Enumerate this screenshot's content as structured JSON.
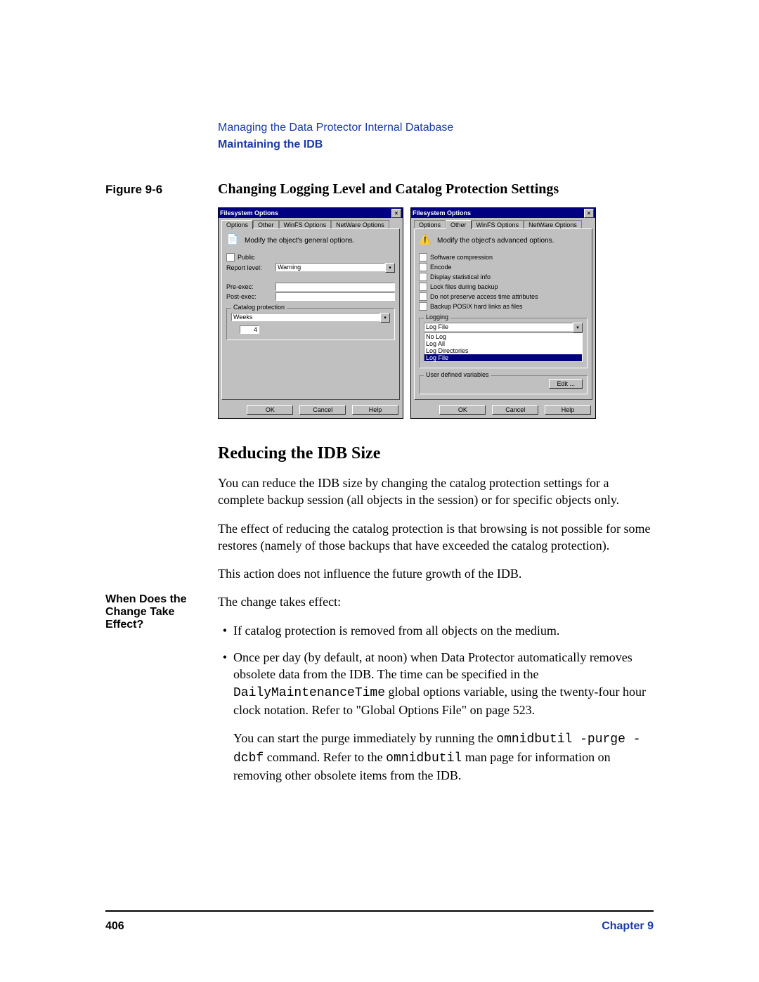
{
  "header": {
    "chapter_line": "Managing the Data Protector Internal Database",
    "subtitle": "Maintaining the IDB"
  },
  "figure": {
    "label": "Figure 9-6",
    "caption": "Changing Logging Level and Catalog Protection Settings"
  },
  "dialog_left": {
    "title": "Filesystem Options",
    "tabs": [
      "Options",
      "Other",
      "WinFS Options",
      "NetWare Options"
    ],
    "active_tab": 0,
    "info": "Modify the object's general options.",
    "public_label": "Public",
    "report_level_label": "Report level:",
    "report_level_value": "Warning",
    "preexec_label": "Pre-exec:",
    "postexec_label": "Post-exec:",
    "catalog_group": "Catalog protection",
    "catalog_unit": "Weeks",
    "catalog_value": "4",
    "ok": "OK",
    "cancel": "Cancel",
    "help": "Help"
  },
  "dialog_right": {
    "title": "Filesystem Options",
    "tabs": [
      "Options",
      "Other",
      "WinFS Options",
      "NetWare Options"
    ],
    "active_tab": 1,
    "info": "Modify the object's advanced options.",
    "checks": [
      "Software compression",
      "Encode",
      "Display statistical info",
      "Lock files during backup",
      "Do not preserve access time attributes",
      "Backup POSIX hard links as files"
    ],
    "logging_group": "Logging",
    "logging_selected": "Log File",
    "logging_options": [
      "No Log",
      "Log All",
      "Log Directories",
      "Log File"
    ],
    "user_vars_group": "User defined variables",
    "edit": "Edit ...",
    "ok": "OK",
    "cancel": "Cancel",
    "help": "Help"
  },
  "section_heading": "Reducing the IDB Size",
  "para1": "You can reduce the IDB size by changing the catalog protection settings for a complete backup session (all objects in the session) or for specific objects only.",
  "para2": "The effect of reducing the catalog protection is that browsing is not possible for some restores (namely of those backups that have exceeded the catalog protection).",
  "para3": "This action does not influence the future growth of the IDB.",
  "side_heading": "When Does the Change Take Effect?",
  "change_intro": "The change takes effect:",
  "bullet1": "If catalog protection is removed from all objects on the medium.",
  "bullet2_a": "Once per day (by default, at noon) when Data Protector automatically removes obsolete data from the IDB. The time can be specified in the ",
  "bullet2_code1": "DailyMaintenanceTime",
  "bullet2_b": " global options variable, using the twenty-four hour clock notation. Refer to \"Global Options File\" on page 523.",
  "tail_a": "You can start the purge immediately by running the ",
  "tail_code1": "omnidbutil -purge -dcbf",
  "tail_b": " command. Refer to the ",
  "tail_code2": "omnidbutil",
  "tail_c": " man page for information on removing other obsolete items from the IDB.",
  "footer": {
    "page": "406",
    "chapter": "Chapter 9"
  }
}
